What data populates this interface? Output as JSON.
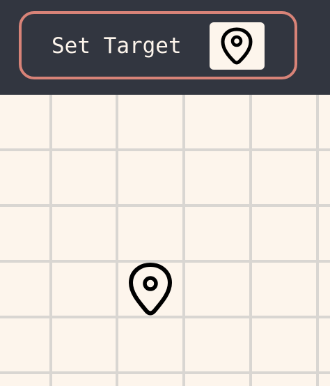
{
  "toolbar": {
    "set_target_label": "Set Target",
    "set_target_icon": "map-pin-icon"
  },
  "map": {
    "marker_icon": "map-pin-icon"
  },
  "colors": {
    "toolbar_bg": "#323640",
    "button_border": "#d88378",
    "map_bg": "#fdf5ec",
    "grid_line": "#d9d6d2",
    "icon": "#000000"
  }
}
